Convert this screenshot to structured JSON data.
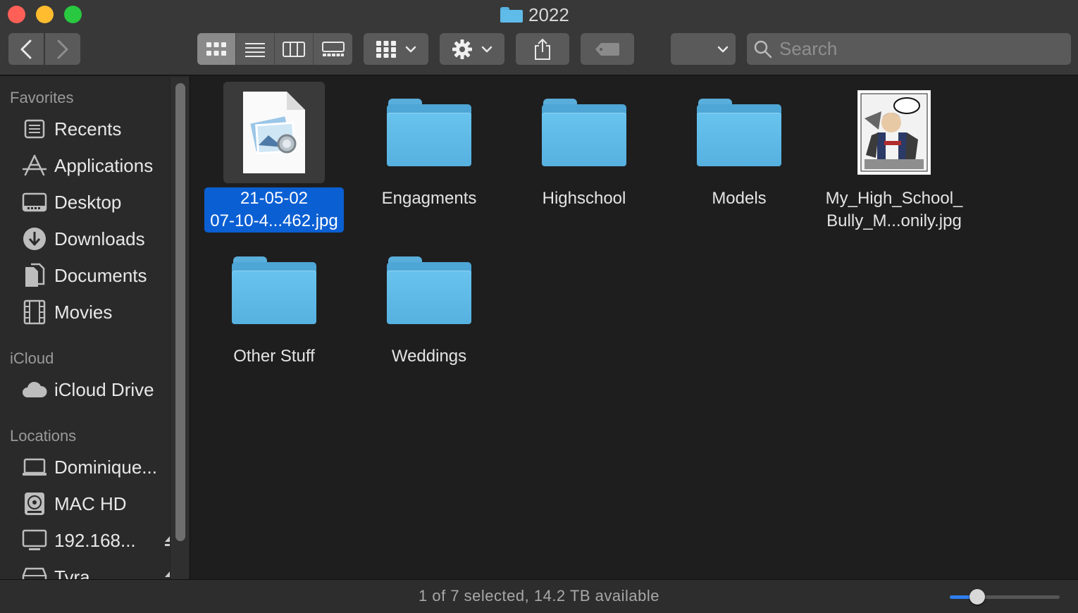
{
  "window": {
    "title": "2022"
  },
  "search": {
    "placeholder": "Search"
  },
  "sidebar": {
    "favorites_heading": "Favorites",
    "favorites": [
      {
        "label": "Recents",
        "icon": "recents-icon"
      },
      {
        "label": "Applications",
        "icon": "applications-icon"
      },
      {
        "label": "Desktop",
        "icon": "desktop-icon"
      },
      {
        "label": "Downloads",
        "icon": "downloads-icon"
      },
      {
        "label": "Documents",
        "icon": "documents-icon"
      },
      {
        "label": "Movies",
        "icon": "movies-icon"
      }
    ],
    "icloud_heading": "iCloud",
    "icloud": [
      {
        "label": "iCloud Drive",
        "icon": "cloud-icon"
      }
    ],
    "locations_heading": "Locations",
    "locations": [
      {
        "label": "Dominique...",
        "icon": "laptop-icon"
      },
      {
        "label": "MAC HD",
        "icon": "disk-icon"
      },
      {
        "label": "192.168...",
        "icon": "monitor-icon"
      },
      {
        "label": "Tyra",
        "icon": "server-icon"
      }
    ]
  },
  "files": [
    {
      "name": "21-05-02\n07-10-4...462.jpg",
      "type": "image-doc",
      "selected": true
    },
    {
      "name": "Engagments",
      "type": "folder"
    },
    {
      "name": "Highschool",
      "type": "folder"
    },
    {
      "name": "Models",
      "type": "folder"
    },
    {
      "name": "My_High_School_\nBully_M...onily.jpg",
      "type": "image-thumb"
    },
    {
      "name": "Other Stuff",
      "type": "folder"
    },
    {
      "name": "Weddings",
      "type": "folder"
    }
  ],
  "status": {
    "text": "1 of 7 selected, 14.2 TB available",
    "zoom_level": 0.25
  },
  "colors": {
    "accent": "#0a5fd3",
    "folder": "#5fbbe8"
  }
}
